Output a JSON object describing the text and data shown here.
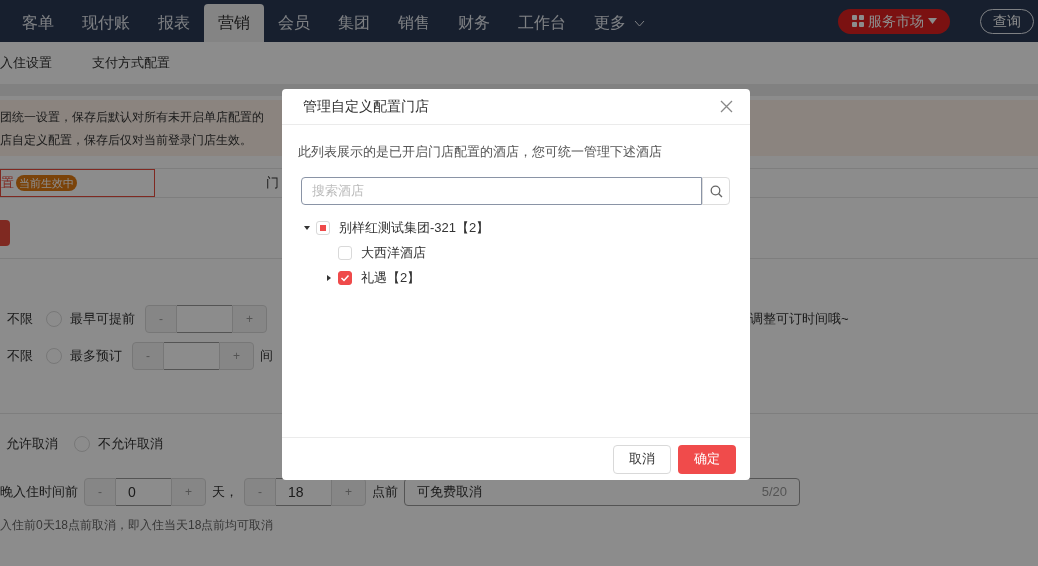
{
  "nav": {
    "tabs": [
      {
        "label": "客单",
        "selected": false
      },
      {
        "label": "现付账",
        "selected": false
      },
      {
        "label": "报表",
        "selected": false
      },
      {
        "label": "营销",
        "selected": true
      },
      {
        "label": "会员",
        "selected": false
      },
      {
        "label": "集团",
        "selected": false
      },
      {
        "label": "销售",
        "selected": false
      },
      {
        "label": "财务",
        "selected": false
      },
      {
        "label": "工作台",
        "selected": false
      }
    ],
    "more": "更多",
    "market_button": "服务市场",
    "query_button": "查询"
  },
  "sub_tabs": [
    "入住设置",
    "支付方式配置"
  ],
  "notice": [
    "团统一设置，保存后默认对所有未开启单店配置的",
    "店自定义配置，保存后仅对当前登录门店生效。"
  ],
  "config_tabs": [
    {
      "label": "置",
      "badge": "当前生效中",
      "selected": true
    },
    {
      "label": "门",
      "selected": false
    }
  ],
  "booking_rows": [
    {
      "lead": "不限",
      "option": {
        "label": "最早可提前",
        "selected": false
      },
      "minus": "-",
      "plus": "+",
      "value": ""
    },
    {
      "lead": "不限",
      "option": {
        "label": "最多预订",
        "selected": false
      },
      "minus": "-",
      "plus": "+",
      "unit": "间",
      "value": ""
    }
  ],
  "booking_hint": "调整可订时间哦~",
  "cancel_options": [
    {
      "label": "允许取消",
      "selected": true
    },
    {
      "label": "不允许取消",
      "selected": false
    }
  ],
  "cancel_rule": {
    "prefix": "晚入住时间前",
    "days_minus": "-",
    "days": "0",
    "days_plus": "+",
    "hour_minus": "-",
    "hour_plus": "+",
    "days_unit": "天，",
    "hour": "18",
    "hour_unit": "点前",
    "text": "可免费取消",
    "count": "5/20"
  },
  "cancel_hint": "入住前0天18点前取消，即入住当天18点前均可取消",
  "dialog": {
    "title": "管理自定义配置门店",
    "description": "此列表展示的是已开启门店配置的酒店，您可统一管理下述酒店",
    "search_placeholder": "搜索酒店",
    "tree": [
      {
        "label": "别样红测试集团-321【2】",
        "indeterminate": true,
        "expanded": true,
        "children": [
          {
            "label": "大西洋酒店",
            "checked": false
          },
          {
            "label": "礼遇【2】",
            "checked": true,
            "expanded": false
          }
        ]
      }
    ],
    "cancel": "取消",
    "confirm": "确定"
  }
}
